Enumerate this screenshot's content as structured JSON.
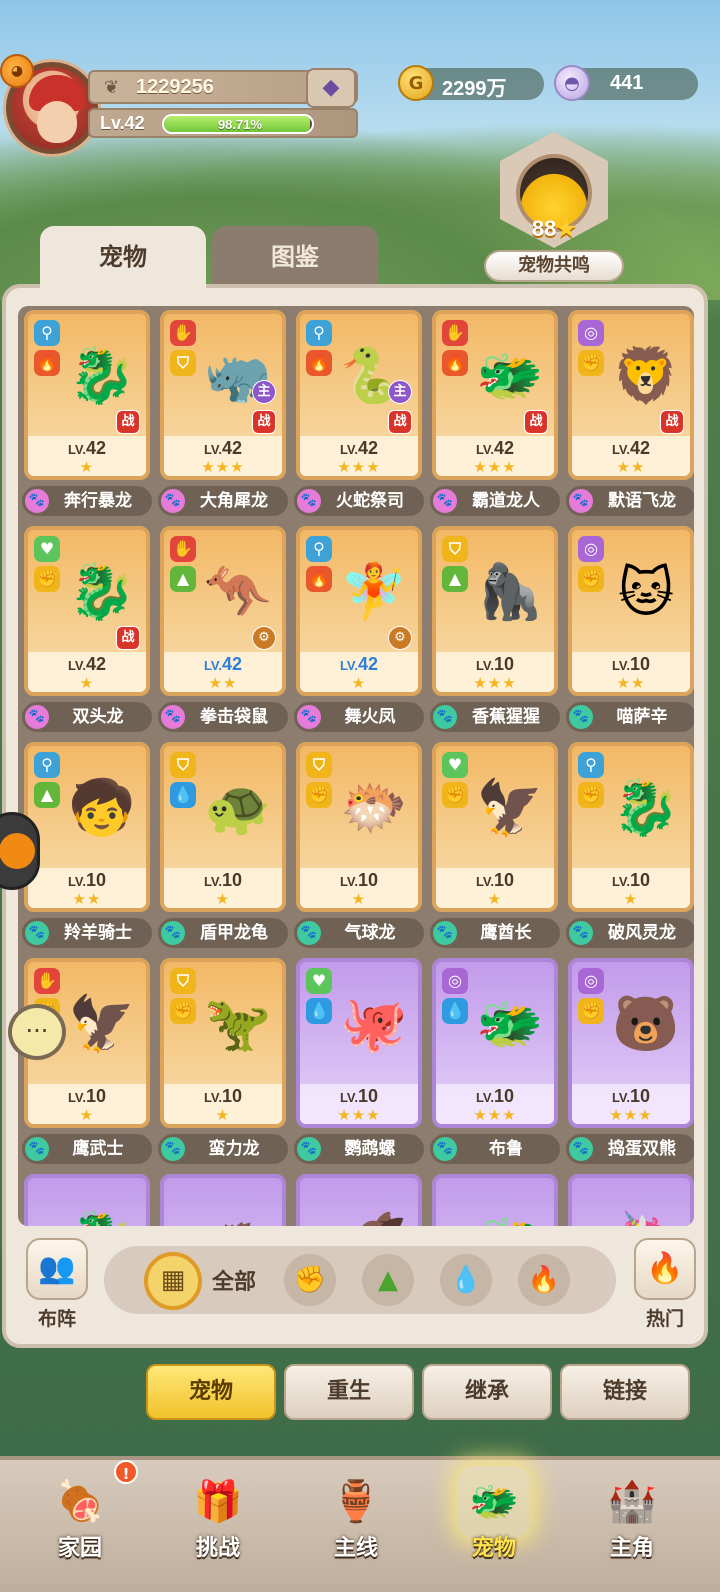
{
  "player": {
    "power": "1229256",
    "level_label": "Lv.42",
    "exp_percent_label": "98.71%",
    "exp_fraction": 0.9871
  },
  "currency": {
    "gold": "2299万",
    "shells": "441"
  },
  "resonance": {
    "count": "88",
    "label": "宠物共鸣"
  },
  "tabs": {
    "pets": "宠物",
    "dex": "图鉴"
  },
  "pets": [
    {
      "name": "奔行暴龙",
      "level": "42",
      "lv_prefix": "LV.",
      "stars": "★",
      "el1": "key",
      "el2": "fire",
      "badge": "战",
      "rarity": "normal",
      "paw": "pink",
      "art": "🐉"
    },
    {
      "name": "大角犀龙",
      "level": "42",
      "lv_prefix": "LV.",
      "stars": "★★★",
      "el1": "claw",
      "el2": "shield",
      "badge": "战",
      "badge2": "主",
      "rarity": "normal",
      "paw": "pink",
      "art": "🦏"
    },
    {
      "name": "火蛇祭司",
      "level": "42",
      "lv_prefix": "LV.",
      "stars": "★★★",
      "el1": "key",
      "el2": "fire",
      "badge": "战",
      "badge2": "主",
      "rarity": "normal",
      "paw": "pink",
      "art": "🐍"
    },
    {
      "name": "霸道龙人",
      "level": "42",
      "lv_prefix": "LV.",
      "stars": "★★★",
      "el1": "claw",
      "el2": "fire",
      "badge": "战",
      "rarity": "normal",
      "paw": "pink",
      "art": "🐲"
    },
    {
      "name": "默语飞龙",
      "level": "42",
      "lv_prefix": "LV.",
      "stars": "★★",
      "el1": "swirl",
      "el2": "fist",
      "badge": "战",
      "rarity": "normal",
      "paw": "pink",
      "art": "🦁"
    },
    {
      "name": "双头龙",
      "level": "42",
      "lv_prefix": "LV.",
      "stars": "★",
      "el1": "heart",
      "el2": "fist",
      "badge": "战",
      "rarity": "normal",
      "paw": "pink",
      "art": "🐉"
    },
    {
      "name": "拳击袋鼠",
      "level": "42",
      "lv_prefix": "LV.",
      "stars": "★★",
      "el1": "claw",
      "el2": "leaf",
      "badge": "gear",
      "rarity": "normal",
      "paw": "pink",
      "art": "🦘",
      "blue": true
    },
    {
      "name": "舞火凤",
      "level": "42",
      "lv_prefix": "LV.",
      "stars": "★",
      "el1": "key",
      "el2": "fire",
      "badge": "gear",
      "rarity": "normal",
      "paw": "pink",
      "art": "🧚",
      "blue": true
    },
    {
      "name": "香蕉猩猩",
      "level": "10",
      "lv_prefix": "LV.",
      "stars": "★★★",
      "el1": "shield",
      "el2": "leaf",
      "rarity": "normal",
      "paw": "teal",
      "art": "🦍"
    },
    {
      "name": "喵萨辛",
      "level": "10",
      "lv_prefix": "LV.",
      "stars": "★★",
      "el1": "swirl",
      "el2": "fist",
      "rarity": "normal",
      "paw": "teal",
      "art": "🐱"
    },
    {
      "name": "羚羊骑士",
      "level": "10",
      "lv_prefix": "LV.",
      "stars": "★★",
      "el1": "key",
      "el2": "leaf",
      "rarity": "normal",
      "paw": "teal",
      "art": "🧒"
    },
    {
      "name": "盾甲龙龟",
      "level": "10",
      "lv_prefix": "LV.",
      "stars": "★",
      "el1": "shield",
      "el2": "water",
      "rarity": "normal",
      "paw": "teal",
      "art": "🐢"
    },
    {
      "name": "气球龙",
      "level": "10",
      "lv_prefix": "LV.",
      "stars": "★",
      "el1": "shield",
      "el2": "fist",
      "rarity": "normal",
      "paw": "teal",
      "art": "🐡"
    },
    {
      "name": "鹰酋长",
      "level": "10",
      "lv_prefix": "LV.",
      "stars": "★",
      "el1": "heart",
      "el2": "fist",
      "rarity": "normal",
      "paw": "teal",
      "art": "🦅"
    },
    {
      "name": "破风灵龙",
      "level": "10",
      "lv_prefix": "LV.",
      "stars": "★",
      "el1": "key",
      "el2": "fist",
      "rarity": "normal",
      "paw": "teal",
      "art": "🐉"
    },
    {
      "name": "鹰武士",
      "level": "10",
      "lv_prefix": "LV.",
      "stars": "★",
      "el1": "claw",
      "el2": "fist",
      "rarity": "normal",
      "paw": "teal",
      "art": "🦅"
    },
    {
      "name": "蛮力龙",
      "level": "10",
      "lv_prefix": "LV.",
      "stars": "★",
      "el1": "shield",
      "el2": "fist",
      "rarity": "normal",
      "paw": "teal",
      "art": "🦖"
    },
    {
      "name": "鹦鹉螺",
      "level": "10",
      "lv_prefix": "LV.",
      "stars": "★★★",
      "el1": "heart",
      "el2": "water",
      "rarity": "rare",
      "paw": "teal",
      "art": "🐙"
    },
    {
      "name": "布鲁",
      "level": "10",
      "lv_prefix": "LV.",
      "stars": "★★★",
      "el1": "swirl",
      "el2": "water",
      "rarity": "rare",
      "paw": "teal",
      "art": "🐲"
    },
    {
      "name": "捣蛋双熊",
      "level": "10",
      "lv_prefix": "LV.",
      "stars": "★★★",
      "el1": "swirl",
      "el2": "fist",
      "rarity": "rare",
      "paw": "teal",
      "art": "🐻"
    }
  ],
  "partial_row_art": [
    "🐉",
    "🦔",
    "🐗",
    "🐲",
    "🦄"
  ],
  "filter": {
    "formation_label": "布阵",
    "all_label": "全部",
    "hot_label": "热门"
  },
  "sub_actions": [
    "宠物",
    "重生",
    "继承",
    "链接"
  ],
  "nav": [
    {
      "label": "家园",
      "icon": "🍖",
      "notify": "!"
    },
    {
      "label": "挑战",
      "icon": "🎁"
    },
    {
      "label": "主线",
      "icon": "🏺"
    },
    {
      "label": "宠物",
      "icon": "🐲",
      "active": true
    },
    {
      "label": "主角",
      "icon": "🏰"
    }
  ],
  "colors": {
    "card_normal": "#f2b866",
    "card_rare": "#c29bea",
    "accent_yellow": "#f2c22d",
    "panel_bg": "#efe7dc"
  }
}
